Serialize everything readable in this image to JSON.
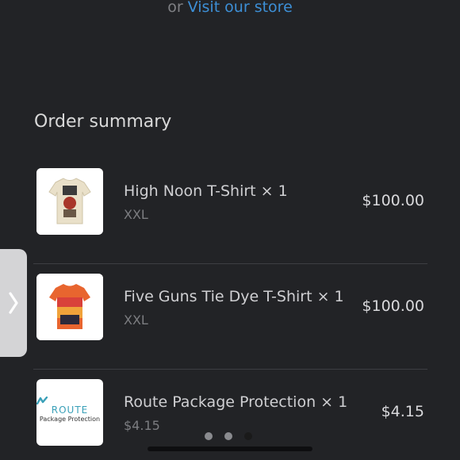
{
  "header": {
    "or_text": "or",
    "store_link": "Visit our store"
  },
  "summary": {
    "title": "Order summary"
  },
  "items": [
    {
      "name": "High Noon T-Shirt × 1",
      "sub": "XXL",
      "price": "$100.00"
    },
    {
      "name": "Five Guns Tie Dye T-Shirt × 1",
      "sub": "XXL",
      "price": "$100.00"
    },
    {
      "name": "Route Package Protection × 1",
      "sub": "$4.15",
      "price": "$4.15"
    }
  ],
  "route_thumb": {
    "logo_text": "ROUTE",
    "caption": "Package Protection"
  },
  "pagination": {
    "count": 3,
    "active": 3
  },
  "colors": {
    "background": "#222326",
    "link": "#3d8fd6",
    "divider": "#3d3e42"
  },
  "icons": {
    "side_tab": "chevron-right-icon",
    "route_logo": "route-mark-icon"
  }
}
